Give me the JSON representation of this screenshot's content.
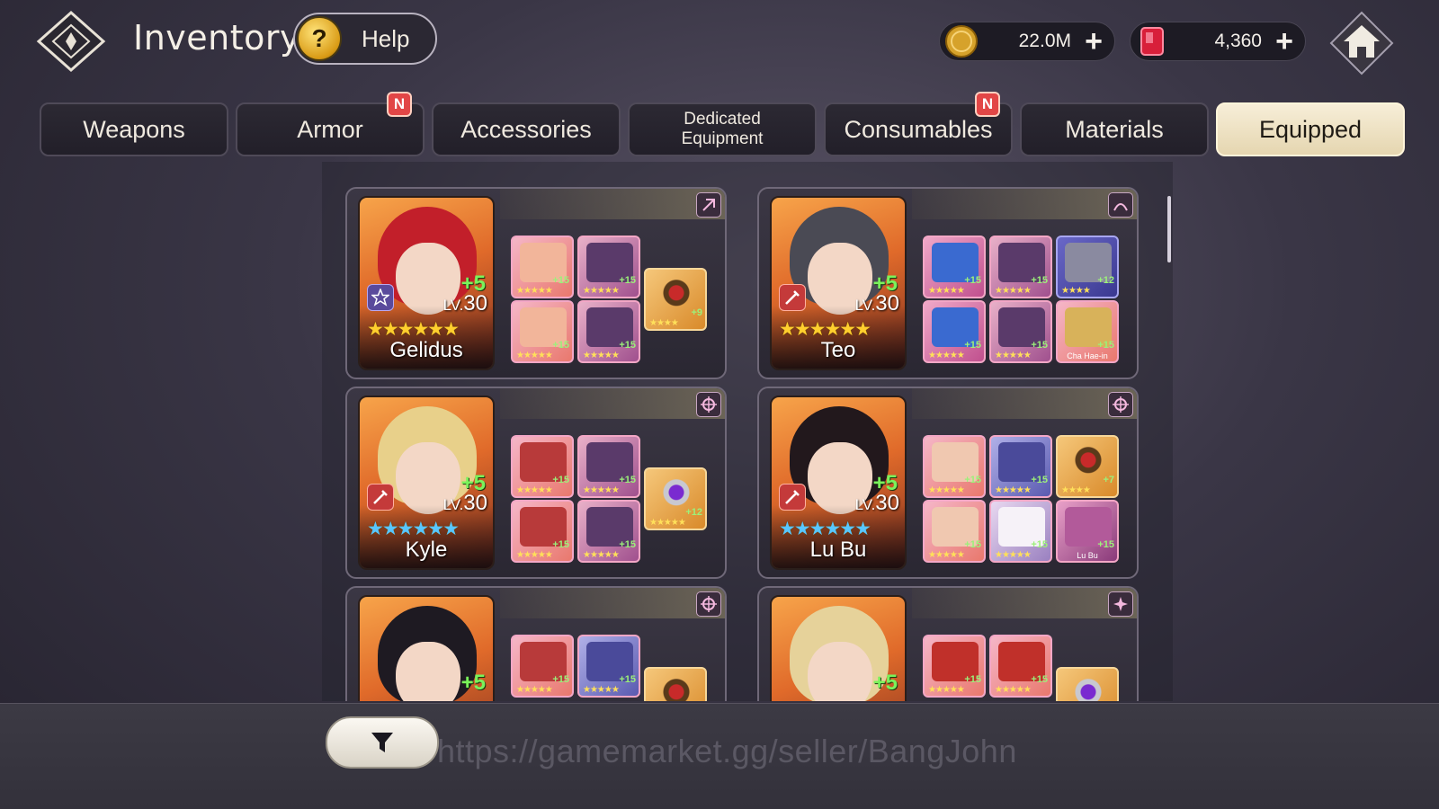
{
  "header": {
    "title": "Inventory",
    "help_label": "Help",
    "gold_value": "22.0M",
    "gems_value": "4,360",
    "plus_symbol": "+"
  },
  "tabs": [
    {
      "label": "Weapons",
      "new": false,
      "active": false
    },
    {
      "label": "Armor",
      "new": true,
      "active": false
    },
    {
      "label": "Accessories",
      "new": false,
      "active": false
    },
    {
      "label": "Dedicated Equipment",
      "new": false,
      "active": false
    },
    {
      "label": "Consumables",
      "new": true,
      "active": false
    },
    {
      "label": "Materials",
      "new": false,
      "active": false
    },
    {
      "label": "Equipped",
      "new": false,
      "active": true
    }
  ],
  "new_badge": "N",
  "heroes": [
    {
      "name": "Gelidus",
      "plus": "+5",
      "level_prefix": "LV.",
      "level": "30",
      "stars": "★★★★★★",
      "star_color": "gold",
      "type": "star",
      "role_icon": "mage-icon",
      "equip_plus": [
        "+15",
        "+15",
        "+15",
        "+15",
        "+9"
      ],
      "equip_owner": ""
    },
    {
      "name": "Teo",
      "plus": "+5",
      "level_prefix": "LV.",
      "level": "30",
      "stars": "★★★★★★",
      "star_color": "gold",
      "type": "sword",
      "role_icon": "assassin-icon",
      "equip_plus": [
        "+15",
        "+15",
        "+12",
        "+15",
        "+15",
        "+15"
      ],
      "equip_owner": "Cha Hae-in"
    },
    {
      "name": "Kyle",
      "plus": "+5",
      "level_prefix": "LV.",
      "level": "30",
      "stars": "★★★★★★",
      "star_color": "blue",
      "type": "sword",
      "role_icon": "target-icon",
      "equip_plus": [
        "+15",
        "+15",
        "+15",
        "+15",
        "+12"
      ],
      "equip_owner": ""
    },
    {
      "name": "Lu Bu",
      "plus": "+5",
      "level_prefix": "LV.",
      "level": "30",
      "stars": "★★★★★★",
      "star_color": "blue",
      "type": "sword",
      "role_icon": "target-icon",
      "equip_plus": [
        "+15",
        "+15",
        "+7",
        "+15",
        "+15",
        "+15"
      ],
      "equip_owner": "Lu Bu"
    },
    {
      "name": "",
      "plus": "+5",
      "level_prefix": "",
      "level": "",
      "stars": "",
      "star_color": "gold",
      "type": "sword",
      "role_icon": "target-icon",
      "equip_plus": [
        "+15",
        "+15"
      ],
      "equip_owner": ""
    },
    {
      "name": "",
      "plus": "+5",
      "level_prefix": "",
      "level": "",
      "stars": "",
      "star_color": "gold",
      "type": "shield",
      "role_icon": "support-icon",
      "equip_plus": [
        "+15",
        "+15"
      ],
      "equip_owner": ""
    }
  ],
  "bottom": {
    "watermark": "https://gamemarket.gg/seller/BangJohn"
  }
}
